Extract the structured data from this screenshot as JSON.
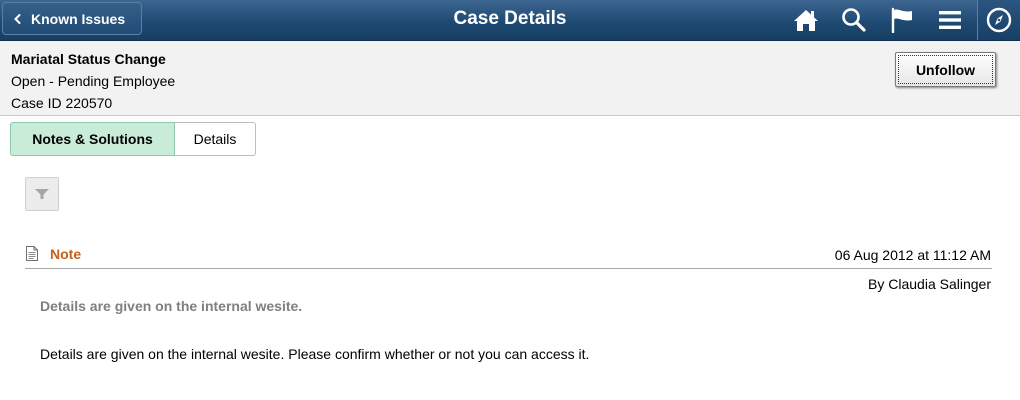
{
  "header": {
    "back_label": "Known Issues",
    "title": "Case Details",
    "icons": [
      "home-icon",
      "search-icon",
      "flag-icon",
      "menu-icon",
      "navbar-compass-icon"
    ],
    "colors": {
      "bar": "#1f4a73",
      "icon": "#ffffff"
    }
  },
  "case": {
    "title": "Mariatal Status Change",
    "status": "Open - Pending Employee",
    "id_text": "Case ID 220570",
    "unfollow_label": "Unfollow"
  },
  "tabs": [
    {
      "label": "Notes & Solutions",
      "active": true
    },
    {
      "label": "Details",
      "active": false
    }
  ],
  "filter": {
    "icon": "filter-icon"
  },
  "note": {
    "type_label": "Note",
    "datetime": "06 Aug 2012 at 11:12 AM",
    "author": "By Claudia Salinger",
    "subject": "Details are given on the internal wesite.",
    "body": "Details are given on the internal wesite. Please confirm whether or not you can access it.",
    "colors": {
      "type_label": "#c4601a",
      "subject": "#7f7f7f"
    }
  }
}
